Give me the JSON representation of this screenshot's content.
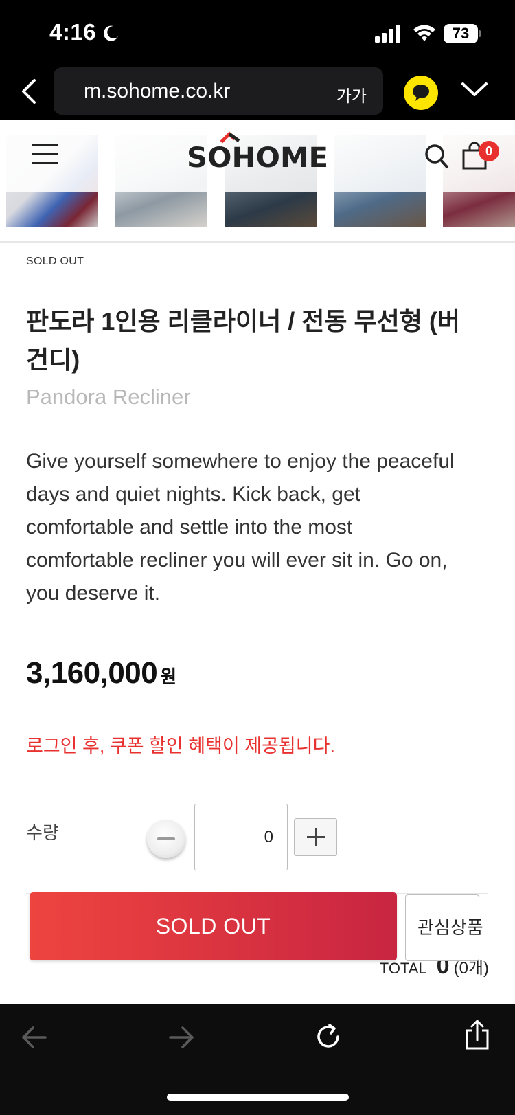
{
  "status_bar": {
    "time": "4:16",
    "battery": "73"
  },
  "browser": {
    "url": "m.sohome.co.kr",
    "text_size_label": "가가"
  },
  "header": {
    "brand": "SOHOME",
    "cart_count": "0"
  },
  "thumbnails": [
    "burgundy and blue recliners",
    "grey recliner",
    "navy recliner",
    "blue recliner",
    "burgundy recliner"
  ],
  "product": {
    "status_tag": "SOLD OUT",
    "title": "판도라 1인용 리클라이너 / 전동 무선형 (버건디)",
    "subtitle": "Pandora Recliner",
    "description": "Give yourself somewhere to enjoy the peaceful days and quiet nights. Kick back, get comfortable and settle into the most comfortable recliner you will ever sit in. Go on, you deserve it.",
    "price": "3,160,000",
    "price_unit": "원",
    "coupon_notice": "로그인 후, 쿠폰 할인 혜택이 제공됩니다."
  },
  "quantity": {
    "label": "수량",
    "value": "0"
  },
  "total": {
    "label": "TOTAL",
    "value": "0",
    "count": "(0개)"
  },
  "actions": {
    "sold_out_label": "SOLD OUT",
    "wishlist_label": "관심상품"
  },
  "colors": {
    "accent_red": "#e8312f",
    "kakao_yellow": "#fee500",
    "button_gradient_start": "#ee4440",
    "button_gradient_end": "#c82541"
  }
}
